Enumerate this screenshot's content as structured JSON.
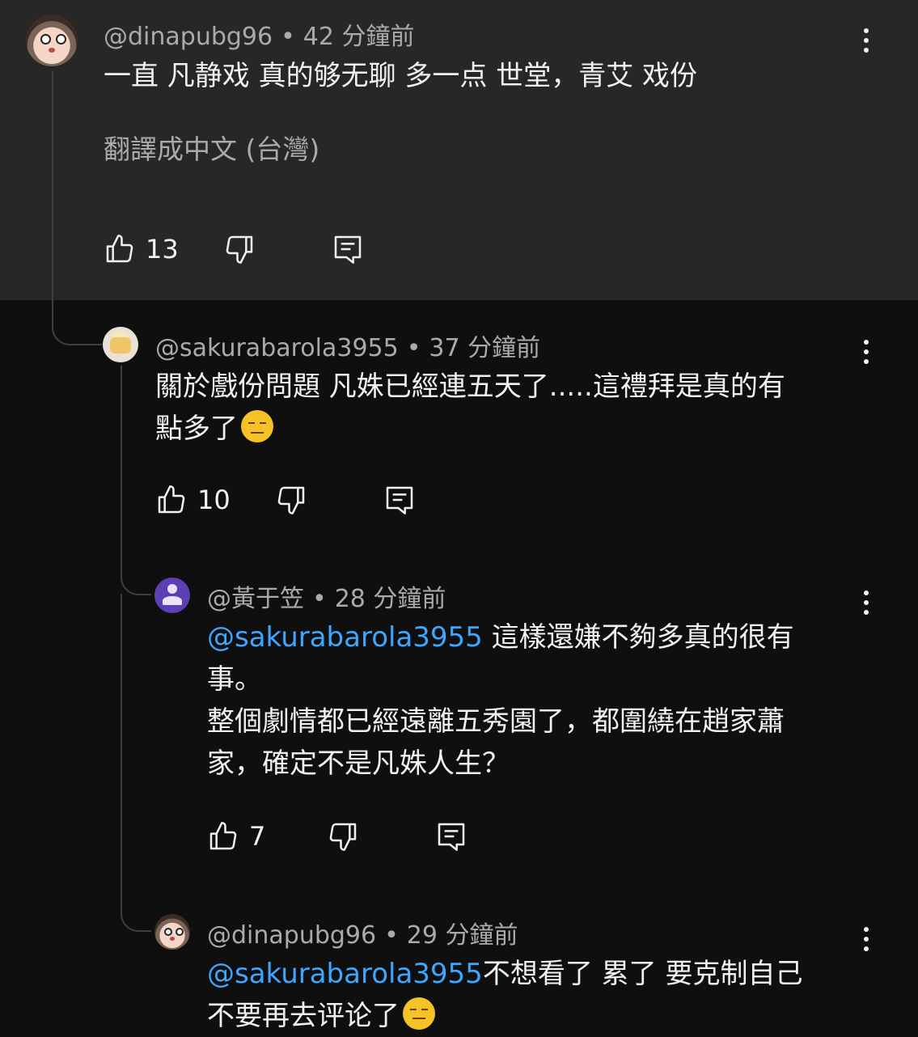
{
  "comments": [
    {
      "author": "@dinapubg96",
      "time": "42 分鐘前",
      "text": "一直 凡静戏 真的够无聊 多一点 世堂，青艾 戏份",
      "translate_label": "翻譯成中文 (台灣)",
      "likes": "13"
    },
    {
      "author": "@sakurabarola3955",
      "time": "37 分鐘前",
      "text_line1": "關於戲份問題 凡姝已經連五天了.....這禮拜是真的有",
      "text_line2": "點多了",
      "likes": "10"
    },
    {
      "author": "@黃于笠",
      "time": "28 分鐘前",
      "mention": "@sakurabarola3955",
      "text_line1": " 這樣還嫌不夠多真的很有",
      "text_line2": "事。",
      "text_line3": "整個劇情都已經遠離五秀園了，都圍繞在趙家蕭",
      "text_line4": "家，確定不是凡姝人生？",
      "likes": "7"
    },
    {
      "author": "@dinapubg96",
      "time": "29 分鐘前",
      "mention": "@sakurabarola3955",
      "text_line1": "不想看了 累了 要克制自己",
      "text_line2": "不要再去评论了"
    }
  ],
  "separator": "•",
  "icons": [
    "thumb-up-icon",
    "thumb-down-icon",
    "reply-icon",
    "more-vert-icon",
    "sleepy-face-emoji",
    "expressionless-face-emoji"
  ],
  "colors": {
    "highlight_bg": "#272727",
    "page_bg": "#0f0f0f",
    "mention": "#3ea6ff",
    "meta": "#aaaaaa"
  }
}
